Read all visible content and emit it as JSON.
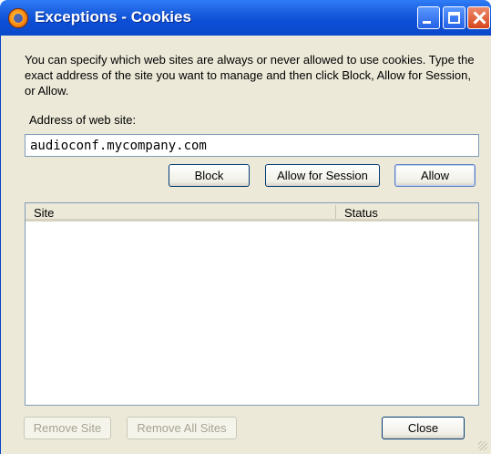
{
  "window": {
    "title": "Exceptions - Cookies"
  },
  "intro_text": "You can specify which web sites are always or never allowed to use cookies. Type the exact address of the site you want to manage and then click Block, Allow for Session, or Allow.",
  "address": {
    "label": "Address of web site:",
    "value": "audioconf.mycompany.com"
  },
  "actions": {
    "block": "Block",
    "allow_session": "Allow for Session",
    "allow": "Allow"
  },
  "list": {
    "columns": [
      "Site",
      "Status"
    ],
    "rows": []
  },
  "footer": {
    "remove_site": "Remove Site",
    "remove_all": "Remove All Sites",
    "close": "Close"
  },
  "icons": {
    "app": "firefox-icon",
    "minimize": "minimize-icon",
    "maximize": "maximize-icon",
    "close": "close-icon"
  }
}
